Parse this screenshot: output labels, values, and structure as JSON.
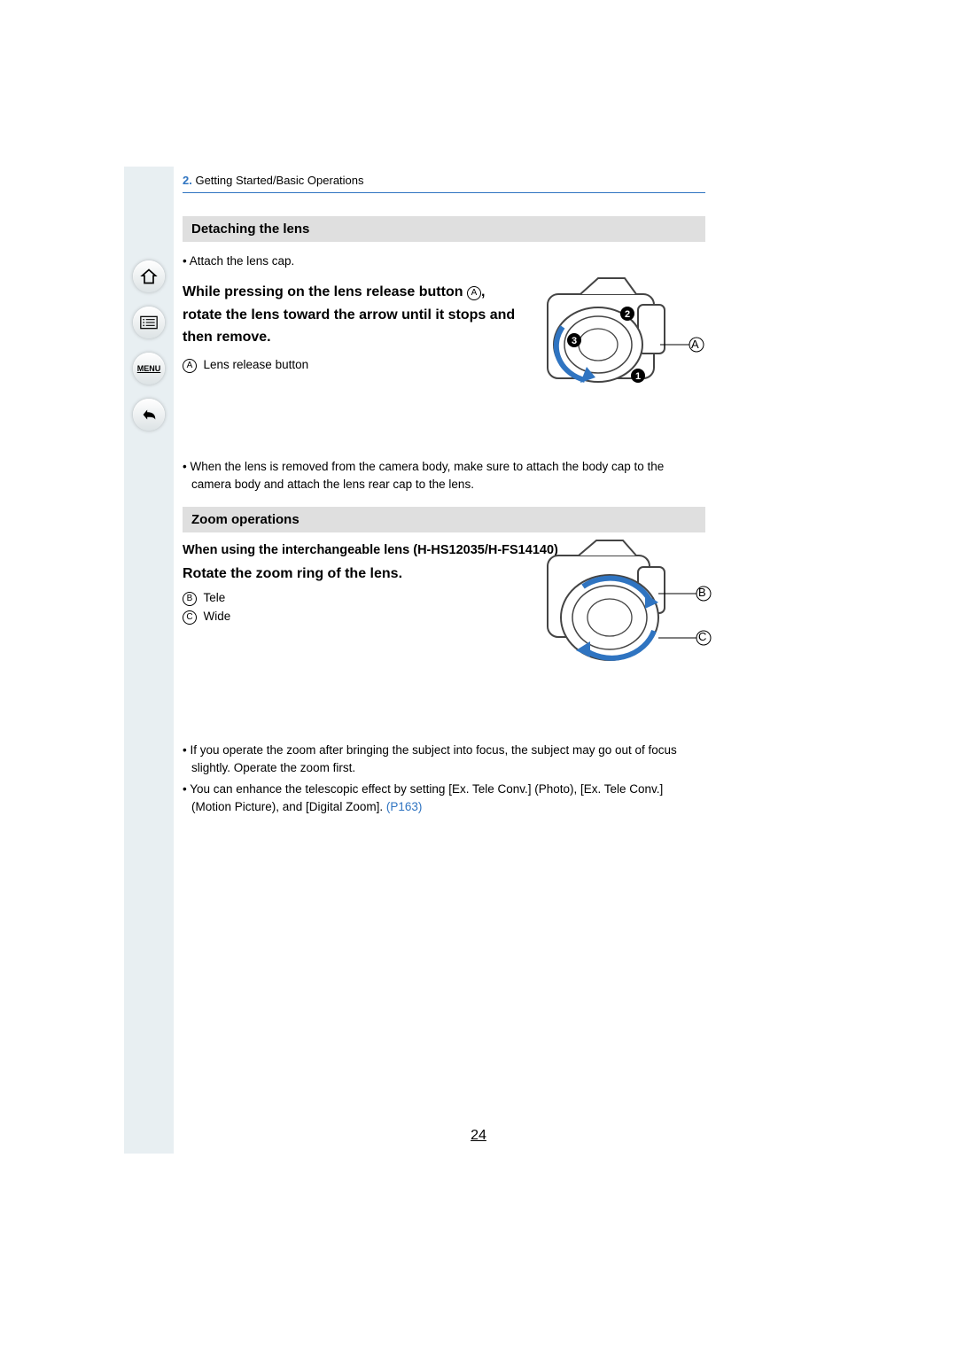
{
  "breadcrumb": {
    "num": "2.",
    "text": "Getting Started/Basic Operations"
  },
  "sidebar": {
    "home": "home-icon",
    "toc": "list-icon",
    "menu_label": "MENU",
    "back": "back-icon"
  },
  "section1": {
    "title": "Detaching the lens",
    "bullet1": "• Attach the lens cap.",
    "instr_p1": "While pressing on the lens release button ",
    "instr_p2": ", rotate the lens toward the arrow until it stops and then remove.",
    "legendA_letter": "A",
    "legendA_text": "Lens release button",
    "note1": "• When the lens is removed from the camera body, make sure to attach the body cap to the camera body and attach the lens rear cap to the lens."
  },
  "section2": {
    "title": "Zoom operations",
    "subhead": "When using the interchangeable lens (H-HS12035/H-FS14140)",
    "instr": "Rotate the zoom ring of the lens.",
    "legendB_letter": "B",
    "legendB_text": "Tele",
    "legendC_letter": "C",
    "legendC_text": "Wide",
    "note1": "• If you operate the zoom after bringing the subject into focus, the subject may go out of focus slightly. Operate the zoom first.",
    "note2_a": "• You can enhance the telescopic effect by setting [Ex. Tele Conv.] (Photo), [Ex. Tele Conv.] (Motion Picture), and [Digital Zoom]. ",
    "note2_link": "(P163)"
  },
  "diagram_labels": {
    "A": "A",
    "B": "B",
    "C": "C"
  },
  "page_number": "24"
}
